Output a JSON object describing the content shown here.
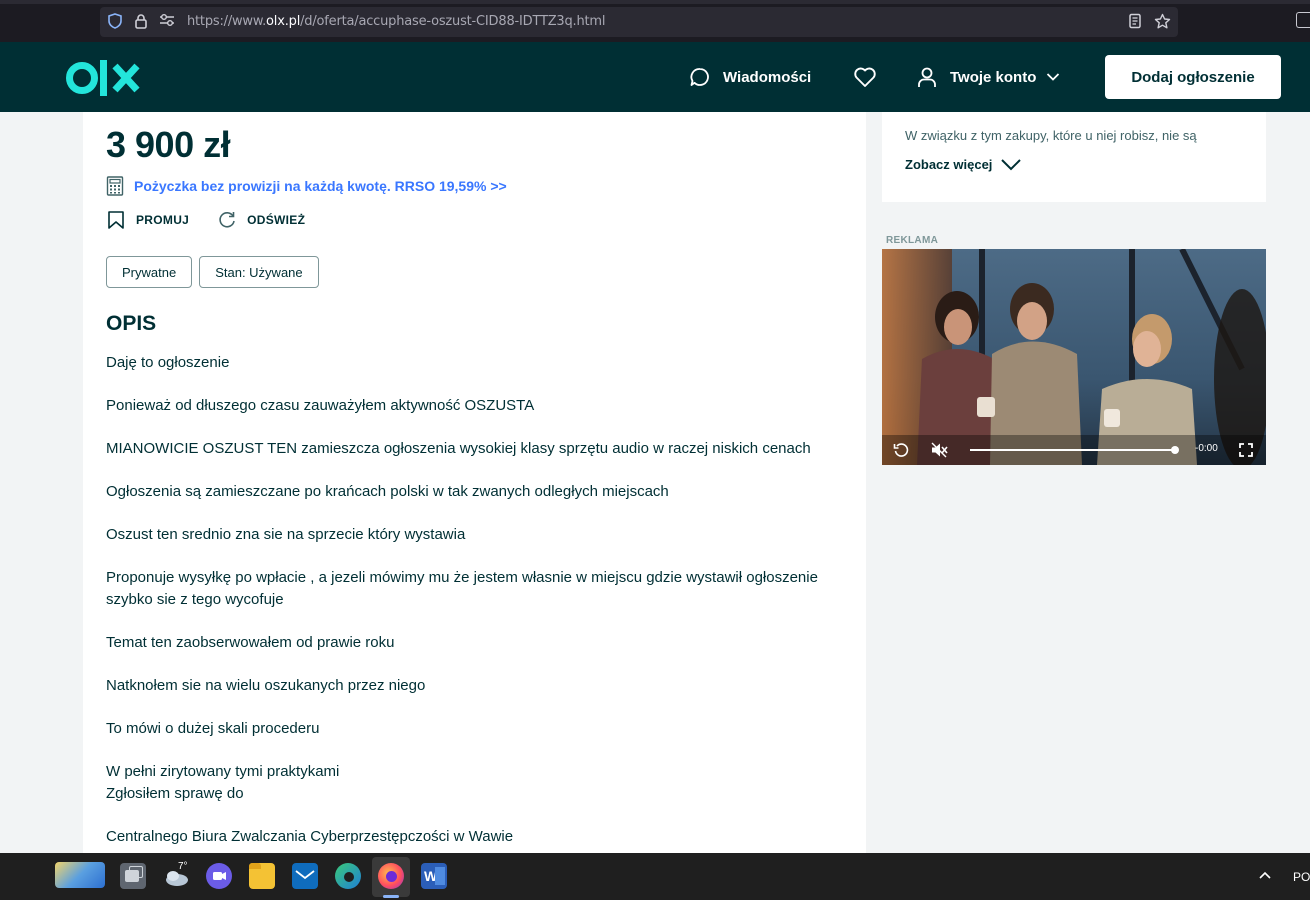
{
  "browser": {
    "url_prefix": "https://www.",
    "url_domain": "olx.pl",
    "url_path": "/d/oferta/accuphase-oszust-CID88-IDTTZ3q.html"
  },
  "header": {
    "messages_label": "Wiadomości",
    "account_label": "Twoje konto",
    "post_button_label": "Dodaj ogłoszenie"
  },
  "listing": {
    "price": "3 900 zł",
    "loan_text": "Pożyczka bez prowizji na każdą kwotę. RRSO 19,59% >>",
    "promote_label": "PROMUJ",
    "refresh_label": "ODŚWIEŻ",
    "tags": [
      "Prywatne",
      "Stan: Używane"
    ],
    "description_title": "OPIS",
    "description_paragraphs": [
      "Daję to ogłoszenie",
      "Ponieważ od dłuszego czasu zauważyłem aktywność OSZUSTA",
      "MIANOWICIE OSZUST TEN zamieszcza ogłoszenia wysokiej klasy sprzętu audio w raczej niskich cenach",
      "Ogłoszenia są zamieszczane po krańcach polski w tak zwanych odległych miejscach",
      "Oszust ten srednio zna sie na sprzecie który wystawia",
      "Proponuje wysyłkę po wpłacie , a jezeli mówimy mu że jestem własnie w miejscu gdzie wystawił ogłoszenie szybko sie z tego wycofuje",
      "Temat ten zaobserwowałem od prawie roku",
      "Natknołem sie na wielu oszukanych przez niego",
      "To mówi o dużej skali procederu",
      "W pełni zirytowany tymi praktykami\nZgłosiłem sprawę do",
      "Centralnego Biura Zwalczania Cyberprzestępczości w Wawie"
    ]
  },
  "side": {
    "text": "W związku z tym zakupy, które u niej robisz, nie są",
    "see_more_label": "Zobacz więcej",
    "ad_label": "REKLAMA",
    "video_time": "-0:00"
  },
  "taskbar": {
    "weather_temp": "7°",
    "lang": "PO"
  }
}
